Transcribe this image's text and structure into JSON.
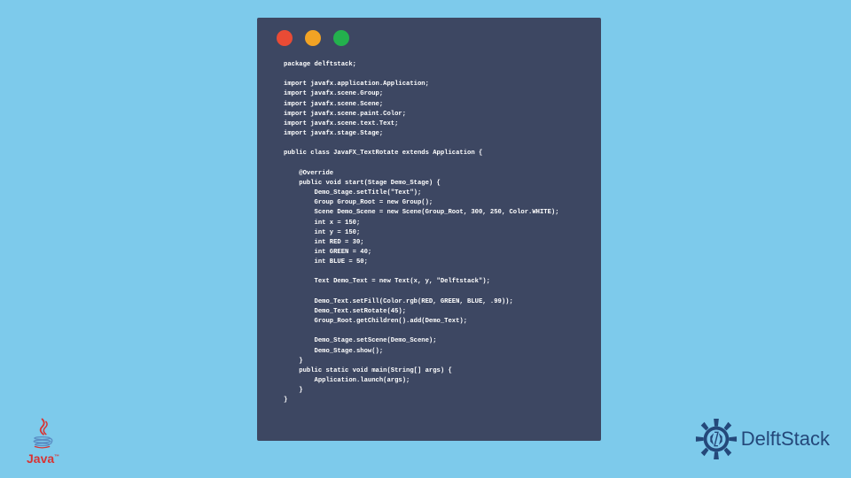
{
  "code": {
    "lines": [
      "package delftstack;",
      "",
      "import javafx.application.Application;",
      "import javafx.scene.Group;",
      "import javafx.scene.Scene;",
      "import javafx.scene.paint.Color;",
      "import javafx.scene.text.Text;",
      "import javafx.stage.Stage;",
      "",
      "public class JavaFX_TextRotate extends Application {",
      "",
      "    @Override",
      "    public void start(Stage Demo_Stage) {",
      "        Demo_Stage.setTitle(\"Text\");",
      "        Group Group_Root = new Group();",
      "        Scene Demo_Scene = new Scene(Group_Root, 300, 250, Color.WHITE);",
      "        int x = 150;",
      "        int y = 150;",
      "        int RED = 30;",
      "        int GREEN = 40;",
      "        int BLUE = 50;",
      "",
      "        Text Demo_Text = new Text(x, y, \"Delftstack\");",
      "",
      "        Demo_Text.setFill(Color.rgb(RED, GREEN, BLUE, .99));",
      "        Demo_Text.setRotate(45);",
      "        Group_Root.getChildren().add(Demo_Text);",
      "",
      "        Demo_Stage.setScene(Demo_Scene);",
      "        Demo_Stage.show();",
      "    }",
      "    public static void main(String[] args) {",
      "        Application.launch(args);",
      "    }",
      "}"
    ]
  },
  "logos": {
    "java_label": "Java",
    "java_tm": "™",
    "delftstack_label": "DelftStack"
  },
  "colors": {
    "background": "#7dcaeb",
    "window": "#3d4762",
    "code_text": "#ffffff",
    "light_red": "#e94b35",
    "light_yellow": "#f2a324",
    "light_green": "#23b14d",
    "java_red": "#d83434",
    "delft_blue": "#24487a"
  }
}
